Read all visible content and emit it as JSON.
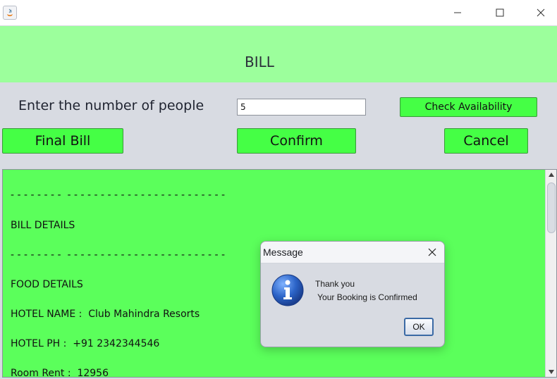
{
  "window": {
    "title": "",
    "controls": [
      "minimize",
      "maximize",
      "close"
    ]
  },
  "header": {
    "title": "BILL"
  },
  "form": {
    "people_label": "Enter the number of people",
    "people_value": "5",
    "check_availability_label": "Check Availability"
  },
  "actions": {
    "final_bill_label": "Final Bill",
    "confirm_label": "Confirm",
    "cancel_label": "Cancel"
  },
  "bill": {
    "divider_1": "- - - - - - - -  - - - - - - - - - - - - - - - - - - - - - - - -",
    "bill_details": "BILL DETAILS",
    "divider_2": "- - - - - - - -  - - - - - - - - - - - - - - - - - - - - - - - -",
    "food_details": "FOOD DETAILS",
    "hotel_name": "HOTEL NAME :  Club Mahindra Resorts",
    "hotel_phone": "HOTEL PH :  +91 2342344546",
    "room_rent": "Room Rent :  12956"
  },
  "dialog": {
    "title": "Message",
    "line1": "Thank you",
    "line2": " Your Booking is Confirmed",
    "ok_label": "OK"
  },
  "colors": {
    "header_bg": "#9cff9c",
    "button_bg": "#45ff45",
    "textarea_bg": "#5bff5b",
    "window_bg": "#d8dbe2"
  },
  "icons": [
    "java-app-icon",
    "minimize-icon",
    "maximize-icon",
    "close-icon",
    "info-icon",
    "dialog-close-icon",
    "scroll-up-icon",
    "scroll-down-icon"
  ]
}
